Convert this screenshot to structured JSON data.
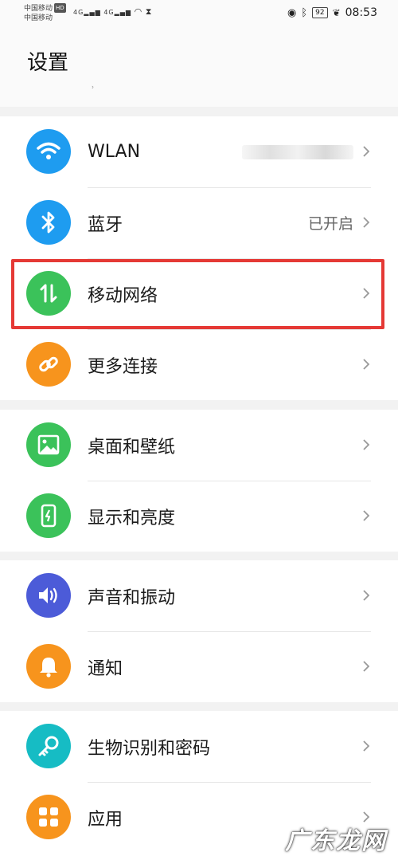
{
  "status_bar": {
    "carrier_1": "中国移动",
    "carrier_1_badge": "HD",
    "carrier_2": "中国移动",
    "network_1": "4G",
    "network_2": "4G",
    "battery": "92",
    "time": "08:53"
  },
  "header": {
    "title": "设置"
  },
  "settings": {
    "group1": [
      {
        "label": "WLAN",
        "value": "",
        "icon": "wifi-icon",
        "color": "#1e9cf0"
      },
      {
        "label": "蓝牙",
        "value": "已开启",
        "icon": "bluetooth-icon",
        "color": "#1e9cf0"
      },
      {
        "label": "移动网络",
        "value": "",
        "icon": "mobile-data-icon",
        "color": "#3bc25a"
      },
      {
        "label": "更多连接",
        "value": "",
        "icon": "link-icon",
        "color": "#f7941d"
      }
    ],
    "group2": [
      {
        "label": "桌面和壁纸",
        "value": "",
        "icon": "wallpaper-icon",
        "color": "#3bc25a"
      },
      {
        "label": "显示和亮度",
        "value": "",
        "icon": "brightness-icon",
        "color": "#3bc25a"
      }
    ],
    "group3": [
      {
        "label": "声音和振动",
        "value": "",
        "icon": "sound-icon",
        "color": "#4c5bd8"
      },
      {
        "label": "通知",
        "value": "",
        "icon": "bell-icon",
        "color": "#f7941d"
      }
    ],
    "group4": [
      {
        "label": "生物识别和密码",
        "value": "",
        "icon": "key-icon",
        "color": "#16bcc4"
      },
      {
        "label": "应用",
        "value": "",
        "icon": "apps-icon",
        "color": "#f7941d"
      }
    ]
  },
  "colors": {
    "highlight": "#e53935"
  },
  "watermark": "广东龙网"
}
